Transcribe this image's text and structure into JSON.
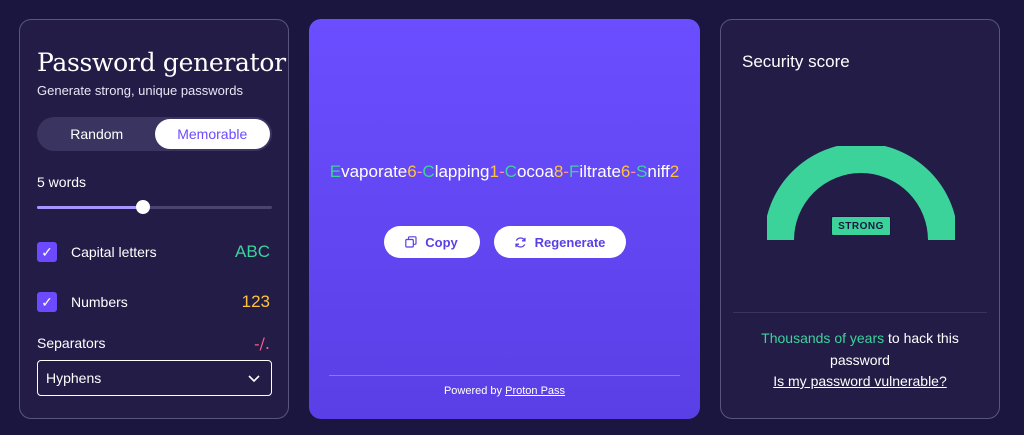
{
  "generator": {
    "title": "Password generator",
    "subtitle": "Generate strong, unique passwords",
    "tabs": [
      {
        "label": "Random",
        "active": false
      },
      {
        "label": "Memorable",
        "active": true
      }
    ],
    "words_label": "5 words",
    "slider_fraction": 0.45,
    "options": [
      {
        "label": "Capital letters",
        "checked": true,
        "sample": "ABC",
        "sample_color": "#3cd39b"
      },
      {
        "label": "Numbers",
        "checked": true,
        "sample": "123",
        "sample_color": "#ffc33a"
      }
    ],
    "separators_label": "Separators",
    "separators_sample": "-/.",
    "separator_select_value": "Hyphens"
  },
  "password": {
    "segments": [
      {
        "text": "E",
        "color": "#3cd39b"
      },
      {
        "text": "vaporate",
        "color": "#ffffff"
      },
      {
        "text": "6",
        "color": "#ffc33a"
      },
      {
        "text": "-",
        "color": "#ff8bb0"
      },
      {
        "text": "C",
        "color": "#3cd39b"
      },
      {
        "text": "lapping",
        "color": "#ffffff"
      },
      {
        "text": "1",
        "color": "#ffc33a"
      },
      {
        "text": "-",
        "color": "#ff8bb0"
      },
      {
        "text": "C",
        "color": "#3cd39b"
      },
      {
        "text": "ocoa",
        "color": "#ffffff"
      },
      {
        "text": "8",
        "color": "#ffc33a"
      },
      {
        "text": "-",
        "color": "#ff8bb0"
      },
      {
        "text": "F",
        "color": "#3cd39b"
      },
      {
        "text": "iltrate",
        "color": "#ffffff"
      },
      {
        "text": "6",
        "color": "#ffc33a"
      },
      {
        "text": "-",
        "color": "#ff8bb0"
      },
      {
        "text": "S",
        "color": "#3cd39b"
      },
      {
        "text": "niff",
        "color": "#ffffff"
      },
      {
        "text": "2",
        "color": "#ffc33a"
      }
    ],
    "copy_label": "Copy",
    "regenerate_label": "Regenerate",
    "powered_prefix": "Powered by ",
    "powered_link": "Proton Pass"
  },
  "security": {
    "title": "Security score",
    "badge": "STRONG",
    "gauge_fraction": 1.0,
    "gauge_color": "#3cd39b",
    "hack_highlight": "Thousands of years",
    "hack_rest": " to hack this password",
    "vulnerable_link": "Is my password vulnerable?"
  },
  "icons": {
    "check": "check-icon",
    "chevron": "chevron-down-icon",
    "copy": "copy-icon",
    "regenerate": "refresh-icon"
  },
  "colors": {
    "accent": "#6d4aff",
    "success": "#3cd39b",
    "background": "#1b1640"
  }
}
